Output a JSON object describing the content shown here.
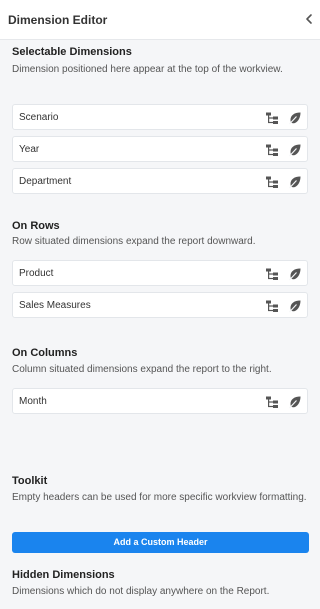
{
  "header": {
    "title": "Dimension Editor"
  },
  "sections": {
    "selectable": {
      "title": "Selectable Dimensions",
      "description": "Dimension positioned here appear at the top of the workview.",
      "items": [
        "Scenario",
        "Year",
        "Department"
      ]
    },
    "rows": {
      "title": "On Rows",
      "description": "Row situated dimensions expand the report downward.",
      "items": [
        "Product",
        "Sales Measures"
      ]
    },
    "columns": {
      "title": "On Columns",
      "description": "Column situated dimensions expand the report to the right.",
      "items": [
        "Month"
      ]
    },
    "toolkit": {
      "title": "Toolkit",
      "description": "Empty headers can be used for more specific workview formatting.",
      "add_button_label": "Add a Custom Header"
    },
    "hidden": {
      "title": "Hidden Dimensions",
      "description": "Dimensions which do not display anywhere on the Report."
    }
  },
  "icons": {
    "collapse": "chevron-left-icon",
    "hierarchy": "hierarchy-icon",
    "subset": "leaf-icon"
  },
  "colors": {
    "accent": "#1a84ee",
    "icon": "#555555",
    "border": "#e3e6ea"
  }
}
